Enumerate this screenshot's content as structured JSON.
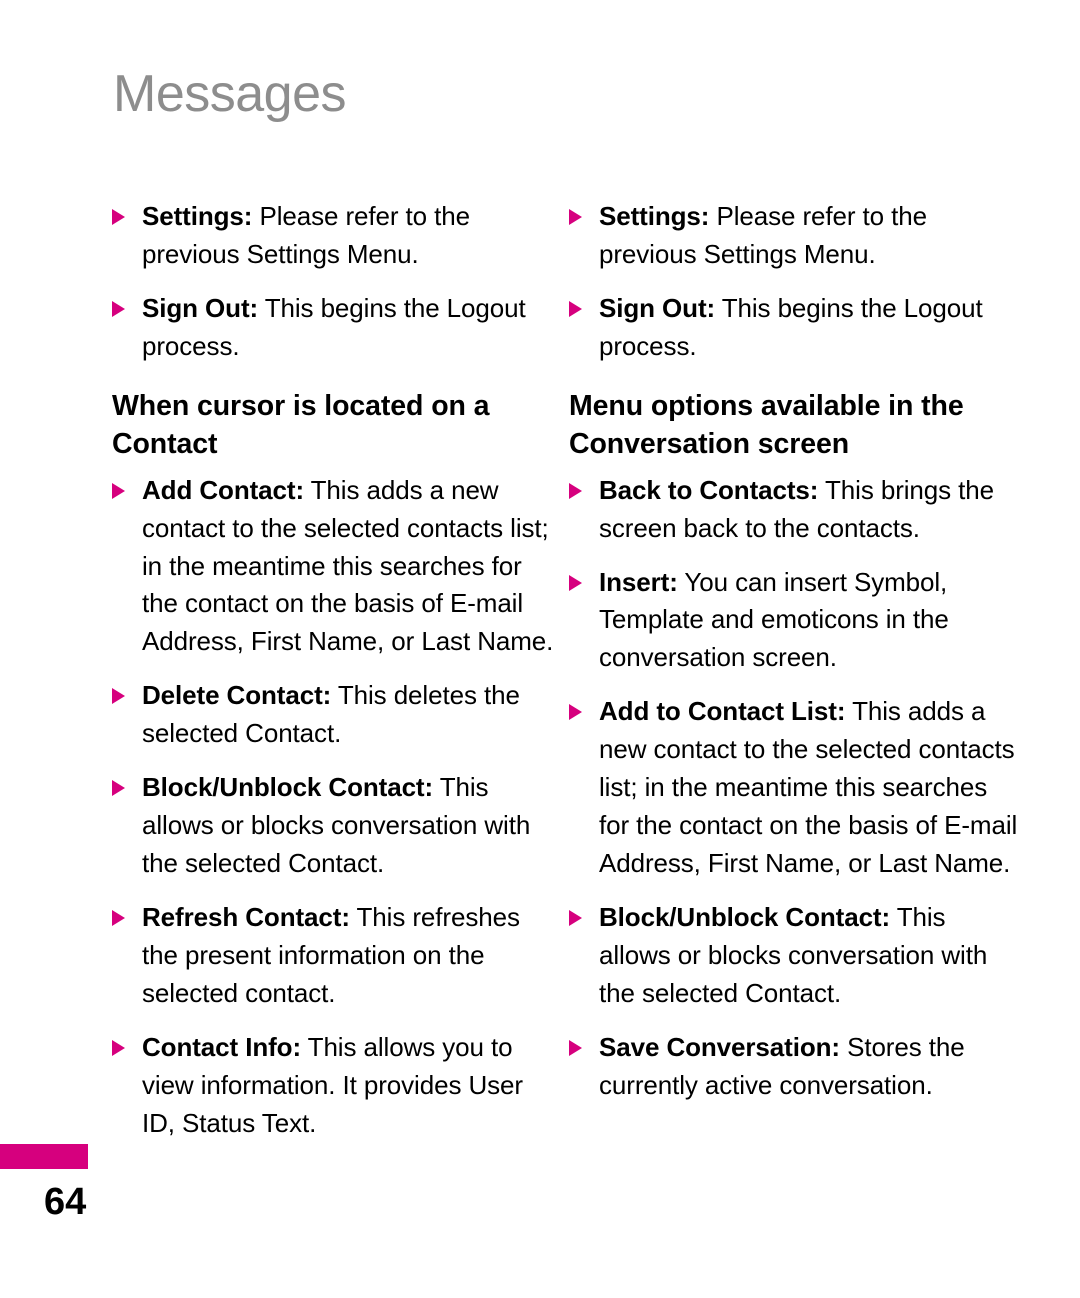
{
  "document": {
    "header_title": "Messages",
    "page_number": "64",
    "accent_color": "#d6007e",
    "header_color": "#8d8d8d",
    "bullet_icon": "triangle-right-icon"
  },
  "left_column": {
    "intro_bullets": [
      {
        "term": "Settings:",
        "desc": " Please refer to the previous Settings Menu."
      },
      {
        "term": "Sign Out:",
        "desc": " This begins the Logout process."
      }
    ],
    "section": {
      "heading": "When cursor is located on a Contact",
      "bullets": [
        {
          "term": "Add Contact:",
          "desc": " This adds a new contact to the selected contacts list; in the meantime this searches for the contact on the basis of E-mail Address, First Name, or Last Name."
        },
        {
          "term": "Delete Contact:",
          "desc": " This deletes the selected Contact."
        },
        {
          "term": "Block/Unblock Contact:",
          "desc": " This allows or blocks conversation with the selected Contact."
        },
        {
          "term": "Refresh Contact:",
          "desc": " This refreshes the present information on the selected contact."
        },
        {
          "term": "Contact Info:",
          "desc": " This allows you to view information. It provides User ID, Status Text."
        }
      ]
    }
  },
  "right_column": {
    "intro_bullets": [
      {
        "term": "Settings:",
        "desc": " Please refer to the previous Settings Menu."
      },
      {
        "term": "Sign Out:",
        "desc": " This begins the Logout process."
      }
    ],
    "section": {
      "heading": "Menu options available in the Conversation screen",
      "bullets": [
        {
          "term": "Back to Contacts:",
          "desc": " This brings the screen back to the contacts."
        },
        {
          "term": "Insert:",
          "desc": " You can insert Symbol, Template and emoticons in the conversation screen."
        },
        {
          "term": "Add to Contact List:",
          "desc": " This adds a new contact to the selected contacts list; in the meantime this searches for the contact on the basis of E-mail Address, First Name, or Last Name."
        },
        {
          "term": "Block/Unblock Contact:",
          "desc": " This allows or blocks conversation with the selected Contact."
        },
        {
          "term": "Save Conversation:",
          "desc": " Stores the currently active conversation."
        }
      ]
    }
  }
}
